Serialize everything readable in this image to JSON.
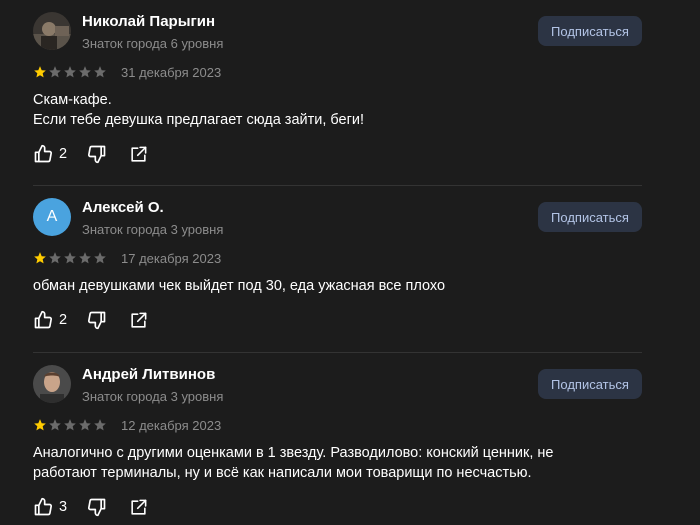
{
  "colors": {
    "background": "#1c1c1c",
    "star_filled": "#ffcc00",
    "star_empty": "#6b6b6b",
    "subscribe_bg": "#2c3444",
    "subscribe_text": "#b3c4e6",
    "avatar_letter_bg": "#4aa3df"
  },
  "reviews": [
    {
      "author": "Николай Парыгин",
      "level": "Знаток города 6 уровня",
      "subscribe_label": "Подписаться",
      "rating": 1,
      "rating_max": 5,
      "date": "31 декабря 2023",
      "text_lines": [
        "Скам-кафе.",
        "Если тебе девушка предлагает сюда зайти, беги!"
      ],
      "likes": "2",
      "avatar": "photo"
    },
    {
      "author": "Алексей О.",
      "level": "Знаток города 3 уровня",
      "subscribe_label": "Подписаться",
      "rating": 1,
      "rating_max": 5,
      "date": "17 декабря 2023",
      "text_lines": [
        "обман девушками чек выйдет под 30, еда ужасная все плохо"
      ],
      "likes": "2",
      "avatar": "letter",
      "avatar_letter": "А"
    },
    {
      "author": "Андрей Литвинов",
      "level": "Знаток города 3 уровня",
      "subscribe_label": "Подписаться",
      "rating": 1,
      "rating_max": 5,
      "date": "12 декабря 2023",
      "text_lines": [
        "Аналогично с другими оценками в 1 звезду. Разводилово: конский ценник, не работают терминалы, ну и всё как написали мои товарищи по несчастью."
      ],
      "likes": "3",
      "avatar": "photo"
    }
  ],
  "icons": {
    "like": "thumbs-up-icon",
    "dislike": "thumbs-down-icon",
    "share": "share-icon",
    "star": "star-icon"
  }
}
